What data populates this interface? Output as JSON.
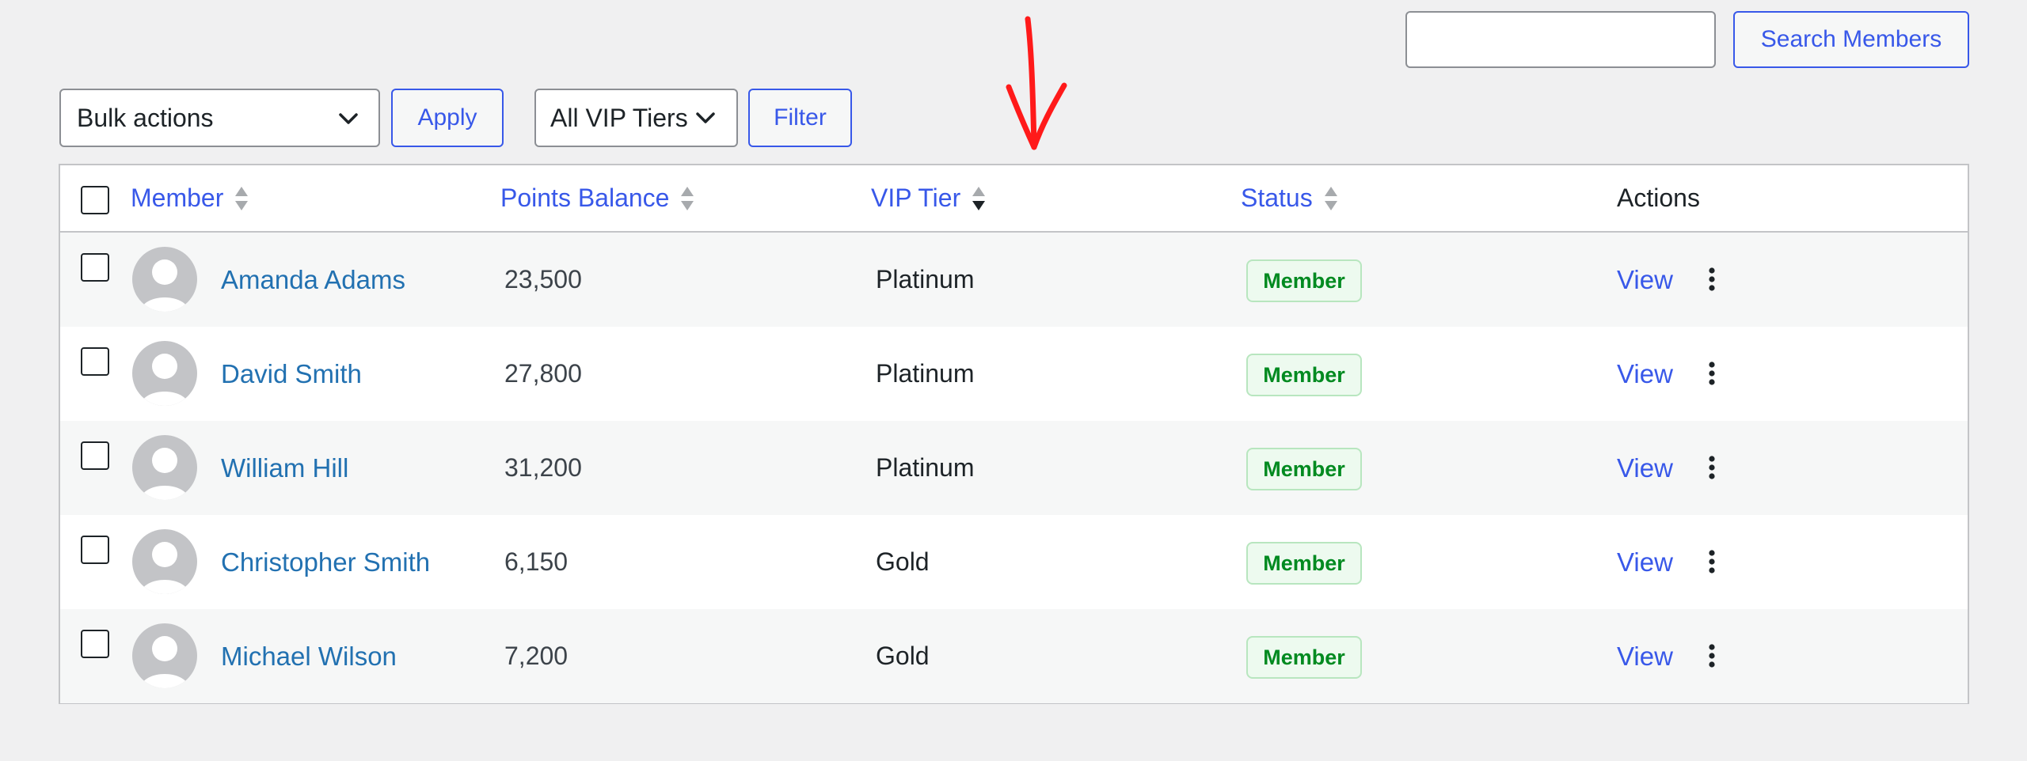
{
  "search": {
    "placeholder": "",
    "button_label": "Search Members"
  },
  "toolbar": {
    "bulk_actions": "Bulk actions",
    "apply_label": "Apply",
    "tier_filter": "All VIP Tiers",
    "filter_label": "Filter"
  },
  "table": {
    "columns": {
      "member": "Member",
      "points": "Points Balance",
      "tier": "VIP Tier",
      "status": "Status",
      "actions": "Actions"
    },
    "rows": [
      {
        "name": "Amanda Adams",
        "points": "23,500",
        "tier": "Platinum",
        "status": "Member",
        "action": "View"
      },
      {
        "name": "David Smith",
        "points": "27,800",
        "tier": "Platinum",
        "status": "Member",
        "action": "View"
      },
      {
        "name": "William Hill",
        "points": "31,200",
        "tier": "Platinum",
        "status": "Member",
        "action": "View"
      },
      {
        "name": "Christopher Smith",
        "points": "6,150",
        "tier": "Gold",
        "status": "Member",
        "action": "View"
      },
      {
        "name": "Michael Wilson",
        "points": "7,200",
        "tier": "Gold",
        "status": "Member",
        "action": "View"
      }
    ]
  },
  "colors": {
    "accent": "#3858e9",
    "link": "#2271b1",
    "badge_green": "#008a20",
    "annotation_red": "#ff1a1a"
  },
  "icons": {
    "select_chevron": "chevron-down-icon",
    "sort": "sort-arrows-icon",
    "row_menu": "more-vertical-icon",
    "avatar": "user-avatar-placeholder",
    "annotation": "red-arrow-down"
  }
}
